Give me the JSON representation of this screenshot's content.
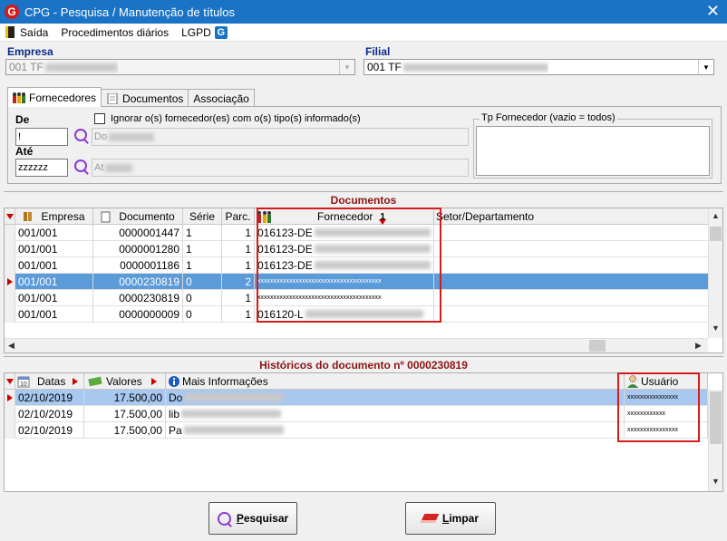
{
  "window": {
    "title": "CPG - Pesquisa / Manutenção de títulos",
    "app_icon": "G",
    "close": "✕"
  },
  "menu": {
    "items": [
      "Saída",
      "Procedimentos diários",
      "LGPD"
    ],
    "lgpd_icon": "G"
  },
  "empresa": {
    "label": "Empresa",
    "value": "001 TF"
  },
  "filial": {
    "label": "Filial",
    "value": "001 TF"
  },
  "tabs": [
    {
      "label": "Fornecedores",
      "icon": "suppliers-icon"
    },
    {
      "label": "Documentos",
      "icon": "document-icon"
    },
    {
      "label": "Associação",
      "icon": ""
    }
  ],
  "filters": {
    "de_label": "De",
    "de_value": "!",
    "de_desc": "Do",
    "ate_label": "Até",
    "ate_value": "zzzzzz",
    "ate_desc": "At",
    "ignore_label": "Ignorar o(s) fornecedor(es) com o(s) tipo(s) informado(s)",
    "tipo_label": "Tp Fornecedor (vazio = todos)"
  },
  "documentos": {
    "title": "Documentos",
    "headers": [
      "Empresa",
      "Documento",
      "Série",
      "Parc.",
      "Fornecedor",
      "Setor/Departamento"
    ],
    "sort_index": "1",
    "rows": [
      {
        "empresa": "001/001",
        "documento": "0000001447",
        "serie": "1",
        "parc": "1",
        "fornecedor": "016123-DE"
      },
      {
        "empresa": "001/001",
        "documento": "0000001280",
        "serie": "1",
        "parc": "1",
        "fornecedor": "016123-DE"
      },
      {
        "empresa": "001/001",
        "documento": "0000001186",
        "serie": "1",
        "parc": "1",
        "fornecedor": "016123-DE"
      },
      {
        "empresa": "001/001",
        "documento": "0000230819",
        "serie": "0",
        "parc": "2",
        "fornecedor": "xxxxxxxxxxxxxxxxxxxxxxxxxxxxxxxxxxxxxxx"
      },
      {
        "empresa": "001/001",
        "documento": "0000230819",
        "serie": "0",
        "parc": "1",
        "fornecedor": "xxxxxxxxxxxxxxxxxxxxxxxxxxxxxxxxxxxxxxx"
      },
      {
        "empresa": "001/001",
        "documento": "0000000009",
        "serie": "0",
        "parc": "1",
        "fornecedor": "016120-L"
      }
    ]
  },
  "historicos": {
    "title": "Históricos do documento nº 0000230819",
    "headers": [
      "Datas",
      "Valores",
      "Mais Informações",
      "Usuário"
    ],
    "rows": [
      {
        "data": "02/10/2019",
        "valor": "17.500,00",
        "info": "Do",
        "usuario": "xxxxxxxxxxxxxxxx"
      },
      {
        "data": "02/10/2019",
        "valor": "17.500,00",
        "info": "lib",
        "usuario": "xxxxxxxxxxxx"
      },
      {
        "data": "02/10/2019",
        "valor": "17.500,00",
        "info": "Pa",
        "usuario": "xxxxxxxxxxxxxxxx"
      }
    ]
  },
  "buttons": {
    "pesquisar_first": "P",
    "pesquisar_rest": "esquisar",
    "limpar_first": "L",
    "limpar_rest": "impar"
  },
  "colors": {
    "titlebar": "#1a73c4",
    "selection": "#5b9bd9",
    "highlight_box": "#d41c1c",
    "section_title": "#8b1414"
  }
}
